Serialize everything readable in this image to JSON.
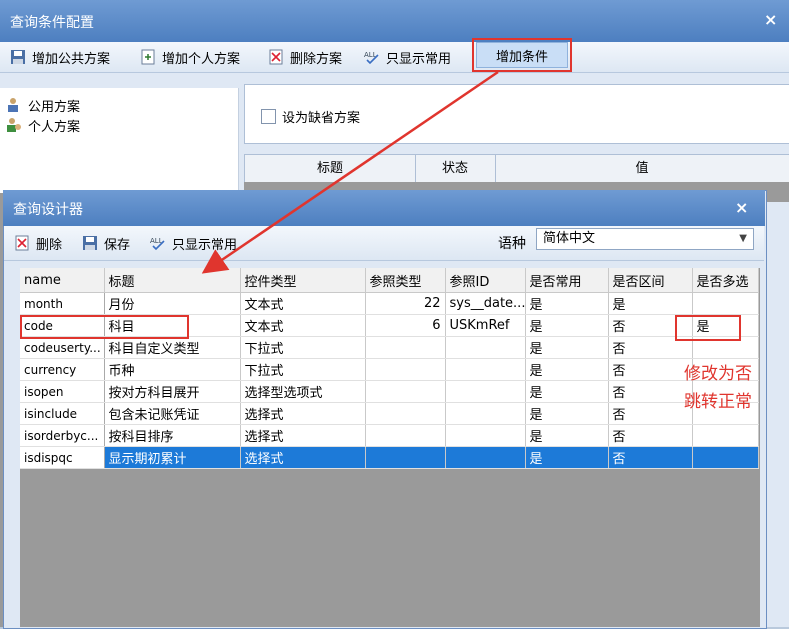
{
  "outer": {
    "title": "查询条件配置",
    "close": "×",
    "toolbar": {
      "add_public": "增加公共方案",
      "add_personal": "增加个人方案",
      "delete": "删除方案",
      "show_common": "只显示常用",
      "add_condition": "增加条件"
    },
    "tree": [
      "公用方案",
      "个人方案"
    ],
    "default_checkbox": "设为缺省方案",
    "grid_headers": [
      "标题",
      "状态",
      "值"
    ]
  },
  "inner": {
    "title": "查询设计器",
    "close": "×",
    "toolbar": {
      "delete": "删除",
      "save": "保存",
      "show_common": "只显示常用",
      "lang_label": "语种",
      "lang_value": "简体中文"
    },
    "columns": [
      "name",
      "标题",
      "控件类型",
      "参照类型",
      "参照ID",
      "是否常用",
      "是否区间",
      "是否多选"
    ],
    "rows": [
      [
        "month",
        "月份",
        "文本式",
        "22",
        "sys__date...",
        "是",
        "是",
        ""
      ],
      [
        "code",
        "科目",
        "文本式",
        "6",
        "USKmRef",
        "是",
        "否",
        "是"
      ],
      [
        "codeuserty...",
        "科目自定义类型",
        "下拉式",
        "",
        "",
        "是",
        "否",
        ""
      ],
      [
        "currency",
        "币种",
        "下拉式",
        "",
        "",
        "是",
        "否",
        ""
      ],
      [
        "isopen",
        "按对方科目展开",
        "选择型选项式",
        "",
        "",
        "是",
        "否",
        ""
      ],
      [
        "isinclude",
        "包含未记账凭证",
        "选择式",
        "",
        "",
        "是",
        "否",
        ""
      ],
      [
        "isorderbyc...",
        "按科目排序",
        "选择式",
        "",
        "",
        "是",
        "否",
        ""
      ],
      [
        "isdispqc",
        "显示期初累计",
        "选择式",
        "",
        "",
        "是",
        "否",
        ""
      ]
    ]
  },
  "annotation": {
    "line1": "修改为否",
    "line2": "跳转正常"
  },
  "colors": {
    "title_bar": "#4d7fc0",
    "selection": "#1d7ad8",
    "annotation_red": "#e0352e"
  }
}
